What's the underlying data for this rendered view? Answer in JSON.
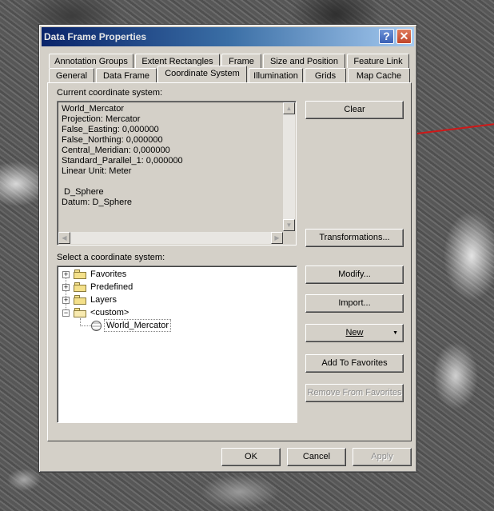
{
  "dialog": {
    "title": "Data Frame Properties",
    "help_glyph": "?",
    "close_glyph": "✕"
  },
  "tabs": {
    "row1": [
      "Annotation Groups",
      "Extent Rectangles",
      "Frame",
      "Size and Position",
      "Feature Link"
    ],
    "row2": [
      "General",
      "Data Frame",
      "Coordinate System",
      "Illumination",
      "Grids",
      "Map Cache"
    ],
    "active": "Coordinate System"
  },
  "current": {
    "label": "Current coordinate system:",
    "text": "World_Mercator\nProjection: Mercator\nFalse_Easting: 0,000000\nFalse_Northing: 0,000000\nCentral_Meridian: 0,000000\nStandard_Parallel_1: 0,000000\nLinear Unit: Meter\n\n D_Sphere\nDatum: D_Sphere"
  },
  "select": {
    "label": "Select a coordinate system:",
    "tree": [
      {
        "label": "Favorites",
        "expander": "+",
        "icon": "folder-icon"
      },
      {
        "label": "Predefined",
        "expander": "+",
        "icon": "folder-icon"
      },
      {
        "label": "Layers",
        "expander": "+",
        "icon": "folder-icon"
      },
      {
        "label": "<custom>",
        "expander": "−",
        "icon": "open-folder-icon"
      },
      {
        "label": "World_Mercator",
        "icon": "globe-icon"
      }
    ]
  },
  "buttons": {
    "clear": "Clear",
    "transformations": "Transformations...",
    "modify": "Modify...",
    "import": "Import...",
    "new": "New",
    "add_favorites": "Add To Favorites",
    "remove_favorites": "Remove From Favorites",
    "ok": "OK",
    "cancel": "Cancel",
    "apply": "Apply"
  },
  "colors": {
    "title_bar_start": "#0a246a",
    "title_bar_end": "#a6caf0",
    "dialog_face": "#d4d0c8",
    "map_line": "#d01818"
  }
}
